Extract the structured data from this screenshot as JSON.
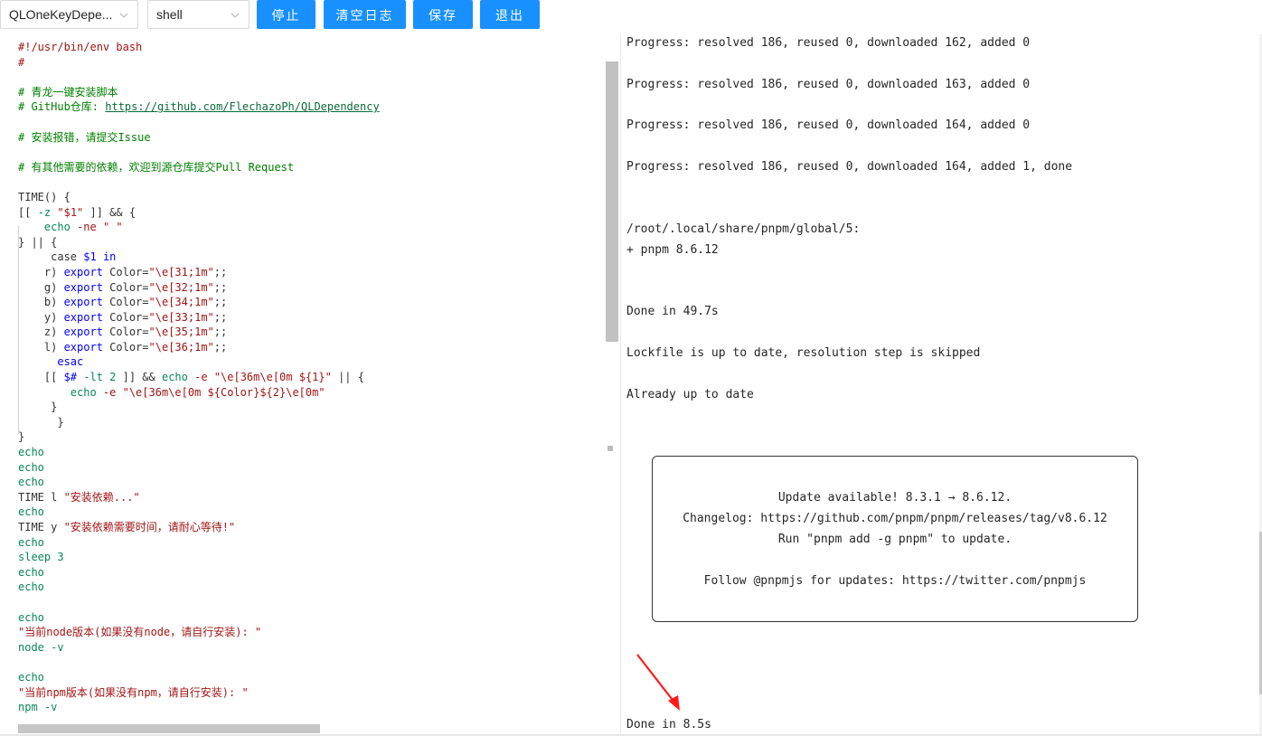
{
  "toolbar": {
    "script_select": "QLOneKeyDepe...",
    "type_select": "shell",
    "stop_label": "停止",
    "clear_log_label": "清空日志",
    "save_label": "保存",
    "exit_label": "退出"
  },
  "editor": {
    "lines": [
      [
        {
          "t": "#!/usr/bin/env bash",
          "c": "c-str"
        }
      ],
      [
        {
          "t": "#",
          "c": "c-str"
        }
      ],
      [],
      [
        {
          "t": "# 青龙一键安装脚本",
          "c": "c-com"
        }
      ],
      [
        {
          "t": "# GitHub仓库: ",
          "c": "c-com"
        },
        {
          "t": "https://github.com/FlechazoPh/QLDependency",
          "c": "c-link"
        }
      ],
      [],
      [
        {
          "t": "# 安装报错，请提交Issue",
          "c": "c-com"
        }
      ],
      [],
      [
        {
          "t": "# 有其他需要的依赖，欢迎到源仓库提交Pull Request",
          "c": "c-com"
        }
      ],
      [],
      [
        {
          "t": "TIME() {",
          "c": ""
        }
      ],
      [
        {
          "t": "[[ ",
          "c": ""
        },
        {
          "t": "-z ",
          "c": "c-cmd"
        },
        {
          "t": "\"$1\"",
          "c": "c-str"
        },
        {
          "t": " ]] && {",
          "c": ""
        }
      ],
      [
        {
          "t": "    ",
          "c": ""
        },
        {
          "t": "echo ",
          "c": "c-cmd"
        },
        {
          "t": "-ne ",
          "c": "c-str"
        },
        {
          "t": "\" \"",
          "c": "c-str"
        }
      ],
      [
        {
          "t": "} || {",
          "c": ""
        }
      ],
      [
        {
          "t": "     case ",
          "c": ""
        },
        {
          "t": "$1 ",
          "c": "c-kw"
        },
        {
          "t": "in",
          "c": "c-kw"
        }
      ],
      [
        {
          "t": "    r) ",
          "c": ""
        },
        {
          "t": "export ",
          "c": "c-kw"
        },
        {
          "t": "Color=",
          "c": ""
        },
        {
          "t": "\"\\e[31;1m\"",
          "c": "c-str"
        },
        {
          "t": ";;",
          "c": ""
        }
      ],
      [
        {
          "t": "    g) ",
          "c": ""
        },
        {
          "t": "export ",
          "c": "c-kw"
        },
        {
          "t": "Color=",
          "c": ""
        },
        {
          "t": "\"\\e[32;1m\"",
          "c": "c-str"
        },
        {
          "t": ";;",
          "c": ""
        }
      ],
      [
        {
          "t": "    b) ",
          "c": ""
        },
        {
          "t": "export ",
          "c": "c-kw"
        },
        {
          "t": "Color=",
          "c": ""
        },
        {
          "t": "\"\\e[34;1m\"",
          "c": "c-str"
        },
        {
          "t": ";;",
          "c": ""
        }
      ],
      [
        {
          "t": "    y) ",
          "c": ""
        },
        {
          "t": "export ",
          "c": "c-kw"
        },
        {
          "t": "Color=",
          "c": ""
        },
        {
          "t": "\"\\e[33;1m\"",
          "c": "c-str"
        },
        {
          "t": ";;",
          "c": ""
        }
      ],
      [
        {
          "t": "    z) ",
          "c": ""
        },
        {
          "t": "export ",
          "c": "c-kw"
        },
        {
          "t": "Color=",
          "c": ""
        },
        {
          "t": "\"\\e[35;1m\"",
          "c": "c-str"
        },
        {
          "t": ";;",
          "c": ""
        }
      ],
      [
        {
          "t": "    l) ",
          "c": ""
        },
        {
          "t": "export ",
          "c": "c-kw"
        },
        {
          "t": "Color=",
          "c": ""
        },
        {
          "t": "\"\\e[36;1m\"",
          "c": "c-str"
        },
        {
          "t": ";;",
          "c": ""
        }
      ],
      [
        {
          "t": "      esac",
          "c": "c-kw"
        }
      ],
      [
        {
          "t": "    [[ ",
          "c": ""
        },
        {
          "t": "$# ",
          "c": "c-kw"
        },
        {
          "t": "-lt ",
          "c": "c-cmd"
        },
        {
          "t": "2",
          "c": "c-cmd"
        },
        {
          "t": " ]] && ",
          "c": ""
        },
        {
          "t": "echo ",
          "c": "c-cmd"
        },
        {
          "t": "-e ",
          "c": "c-str"
        },
        {
          "t": "\"\\e[36m\\e[0m ${1}\"",
          "c": "c-str"
        },
        {
          "t": " || {",
          "c": ""
        }
      ],
      [
        {
          "t": "        ",
          "c": ""
        },
        {
          "t": "echo ",
          "c": "c-cmd"
        },
        {
          "t": "-e ",
          "c": "c-str"
        },
        {
          "t": "\"\\e[36m\\e[0m ${Color}${2}\\e[0m\"",
          "c": "c-str"
        }
      ],
      [
        {
          "t": "     }",
          "c": ""
        }
      ],
      [
        {
          "t": "      }",
          "c": ""
        }
      ],
      [
        {
          "t": "}",
          "c": ""
        }
      ],
      [
        {
          "t": "echo",
          "c": "c-cmd"
        }
      ],
      [
        {
          "t": "echo",
          "c": "c-cmd"
        }
      ],
      [
        {
          "t": "echo",
          "c": "c-cmd"
        }
      ],
      [
        {
          "t": "TIME l ",
          "c": ""
        },
        {
          "t": "\"安装依赖...\"",
          "c": "c-str"
        }
      ],
      [
        {
          "t": "echo",
          "c": "c-cmd"
        }
      ],
      [
        {
          "t": "TIME y ",
          "c": ""
        },
        {
          "t": "\"安装依赖需要时间，请耐心等待!\"",
          "c": "c-str"
        }
      ],
      [
        {
          "t": "echo",
          "c": "c-cmd"
        }
      ],
      [
        {
          "t": "sleep 3",
          "c": "c-cmd"
        }
      ],
      [
        {
          "t": "echo",
          "c": "c-cmd"
        }
      ],
      [
        {
          "t": "echo",
          "c": "c-cmd"
        }
      ],
      [],
      [
        {
          "t": "echo",
          "c": "c-cmd"
        }
      ],
      [
        {
          "t": "\"当前node版本(如果没有node，请自行安装): \"",
          "c": "c-str"
        }
      ],
      [
        {
          "t": "node -v",
          "c": "c-cmd"
        }
      ],
      [],
      [
        {
          "t": "echo",
          "c": "c-cmd"
        }
      ],
      [
        {
          "t": "\"当前npm版本(如果没有npm，请自行安装): \"",
          "c": "c-str"
        }
      ],
      [
        {
          "t": "npm -v",
          "c": "c-cmd"
        }
      ]
    ]
  },
  "log": {
    "progress_1": "Progress: resolved 186, reused 0, downloaded 162, added 0",
    "progress_2": "Progress: resolved 186, reused 0, downloaded 163, added 0",
    "progress_3": "Progress: resolved 186, reused 0, downloaded 164, added 0",
    "progress_4": "Progress: resolved 186, reused 0, downloaded 164, added 1, done",
    "global_path": "/root/.local/share/pnpm/global/5:",
    "pnpm_added": "+ pnpm 8.6.12",
    "done_1": "Done in 49.7s",
    "lockfile": "Lockfile is up to date, resolution step is skipped",
    "already": "Already up to date",
    "update_available": "Update available! 8.3.1 → 8.6.12.",
    "changelog": "Changelog: https://github.com/pnpm/pnpm/releases/tag/v8.6.12",
    "run_cmd": "Run \"pnpm add -g pnpm\" to update.",
    "follow": "Follow @pnpmjs for updates: https://twitter.com/pnpmjs",
    "done_2": "Done in 8.5s"
  },
  "colors": {
    "primary": "#1890ff",
    "annotation_arrow": "#ff1a1a"
  }
}
